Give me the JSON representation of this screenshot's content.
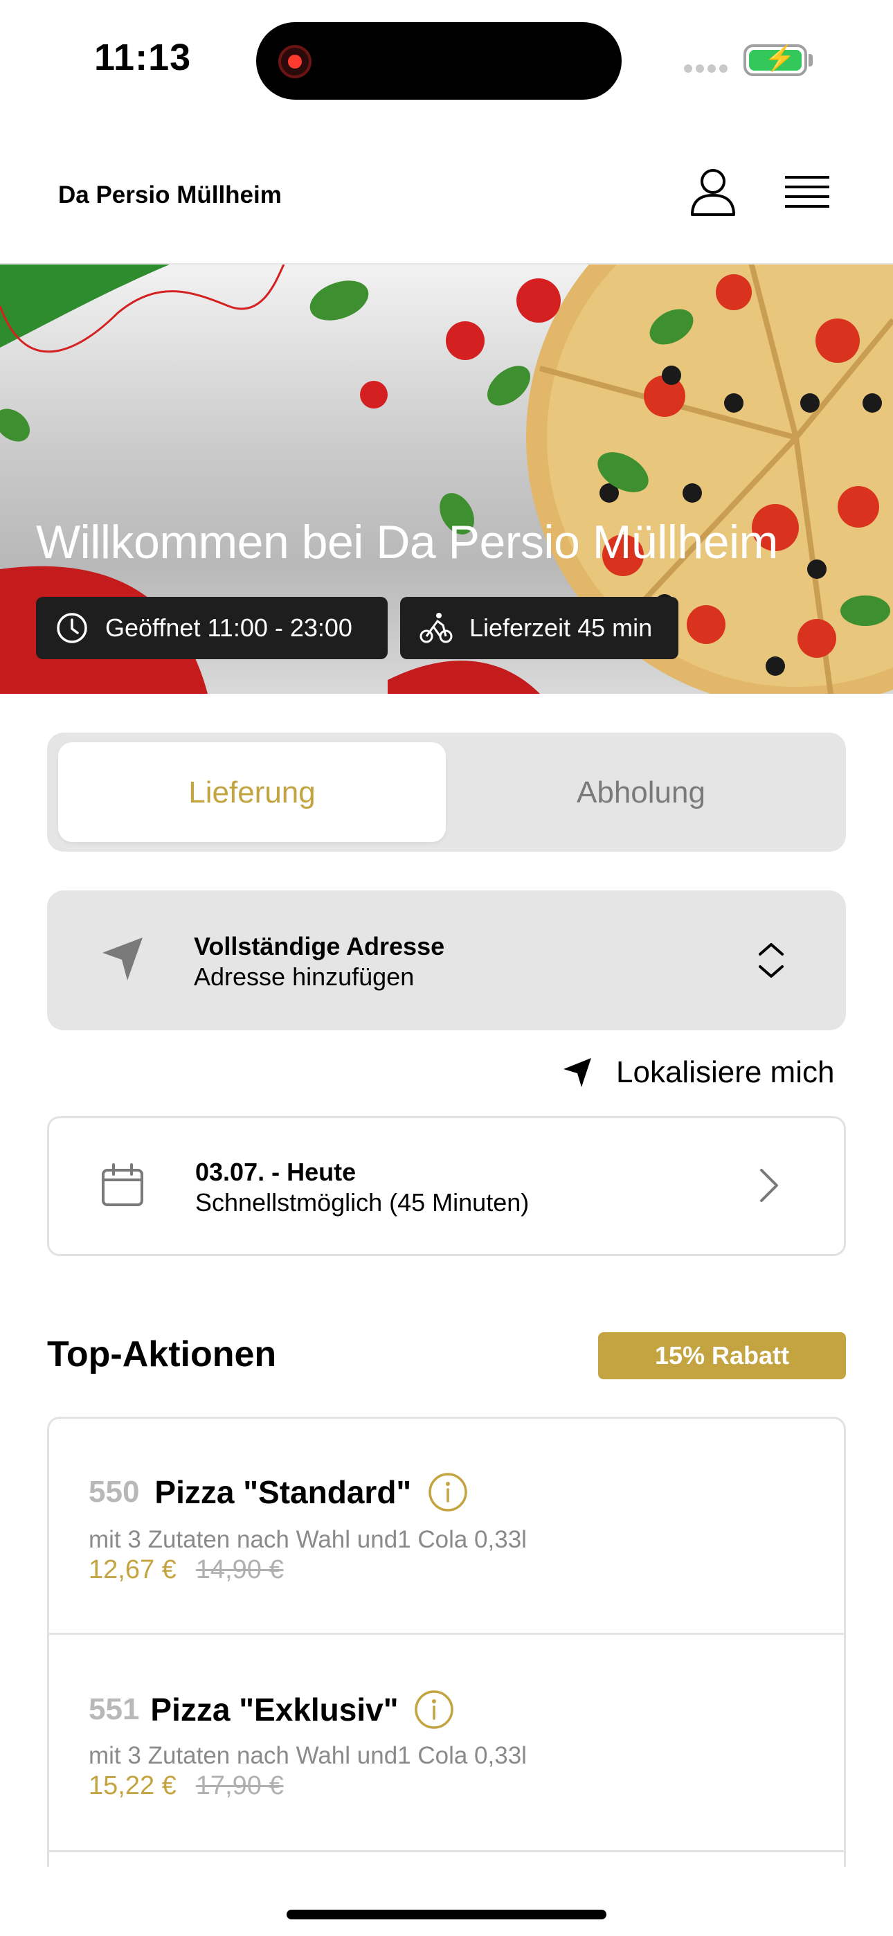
{
  "status_bar": {
    "time": "11:13"
  },
  "header": {
    "restaurant_name": "Da Persio Müllheim"
  },
  "hero": {
    "title": "Willkommen bei Da Persio Müllheim",
    "opening_hours": "Geöffnet 11:00 - 23:00",
    "delivery_time": "Lieferzeit 45 min"
  },
  "order_mode": {
    "options": [
      "Lieferung",
      "Abholung"
    ],
    "selected": "Lieferung"
  },
  "address": {
    "title": "Vollständige Adresse",
    "subtitle": "Adresse hinzufügen",
    "locate_label": "Lokalisiere mich"
  },
  "schedule": {
    "date": "03.07. - Heute",
    "subtitle": "Schnellstmöglich (45 Minuten)"
  },
  "top_actions": {
    "title": "Top-Aktionen",
    "badge": "15% Rabatt",
    "items": [
      {
        "number": "550",
        "name": "Pizza \"Standard\"",
        "description": "mit 3 Zutaten nach Wahl und1 Cola 0,33l",
        "price": "12,67 €",
        "old_price": "14,90 €"
      },
      {
        "number": "551",
        "name": "Pizza \"Exklusiv\"",
        "description": "mit 3 Zutaten nach Wahl und1 Cola 0,33l",
        "price": "15,22 €",
        "old_price": "17,90 €"
      }
    ]
  },
  "colors": {
    "accent": "#c4a440",
    "chip_bg": "#1e1e1e",
    "card_bg": "#e5e5e5"
  },
  "icons": [
    "user-icon",
    "menu-icon",
    "clock-icon",
    "bike-icon",
    "navigation-arrow-icon",
    "updown-chevron-icon",
    "calendar-icon",
    "chevron-right-icon",
    "info-icon"
  ]
}
